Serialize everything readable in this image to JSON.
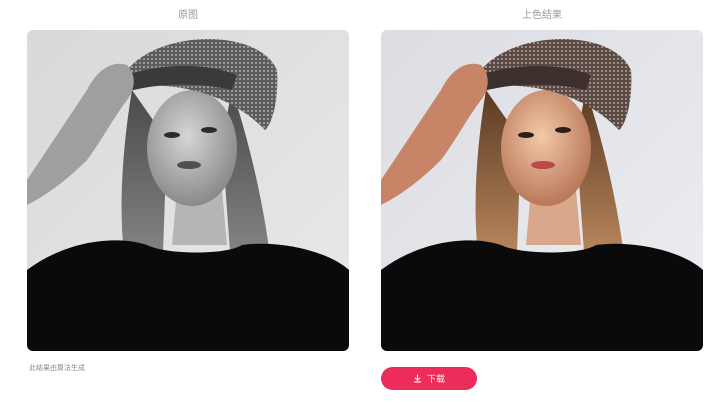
{
  "original": {
    "label": "原图"
  },
  "result": {
    "label": "上色结果"
  },
  "note": "此结果由算法生成",
  "download": {
    "label": "下载",
    "icon": "download-icon",
    "color": "#ec2c5b"
  }
}
